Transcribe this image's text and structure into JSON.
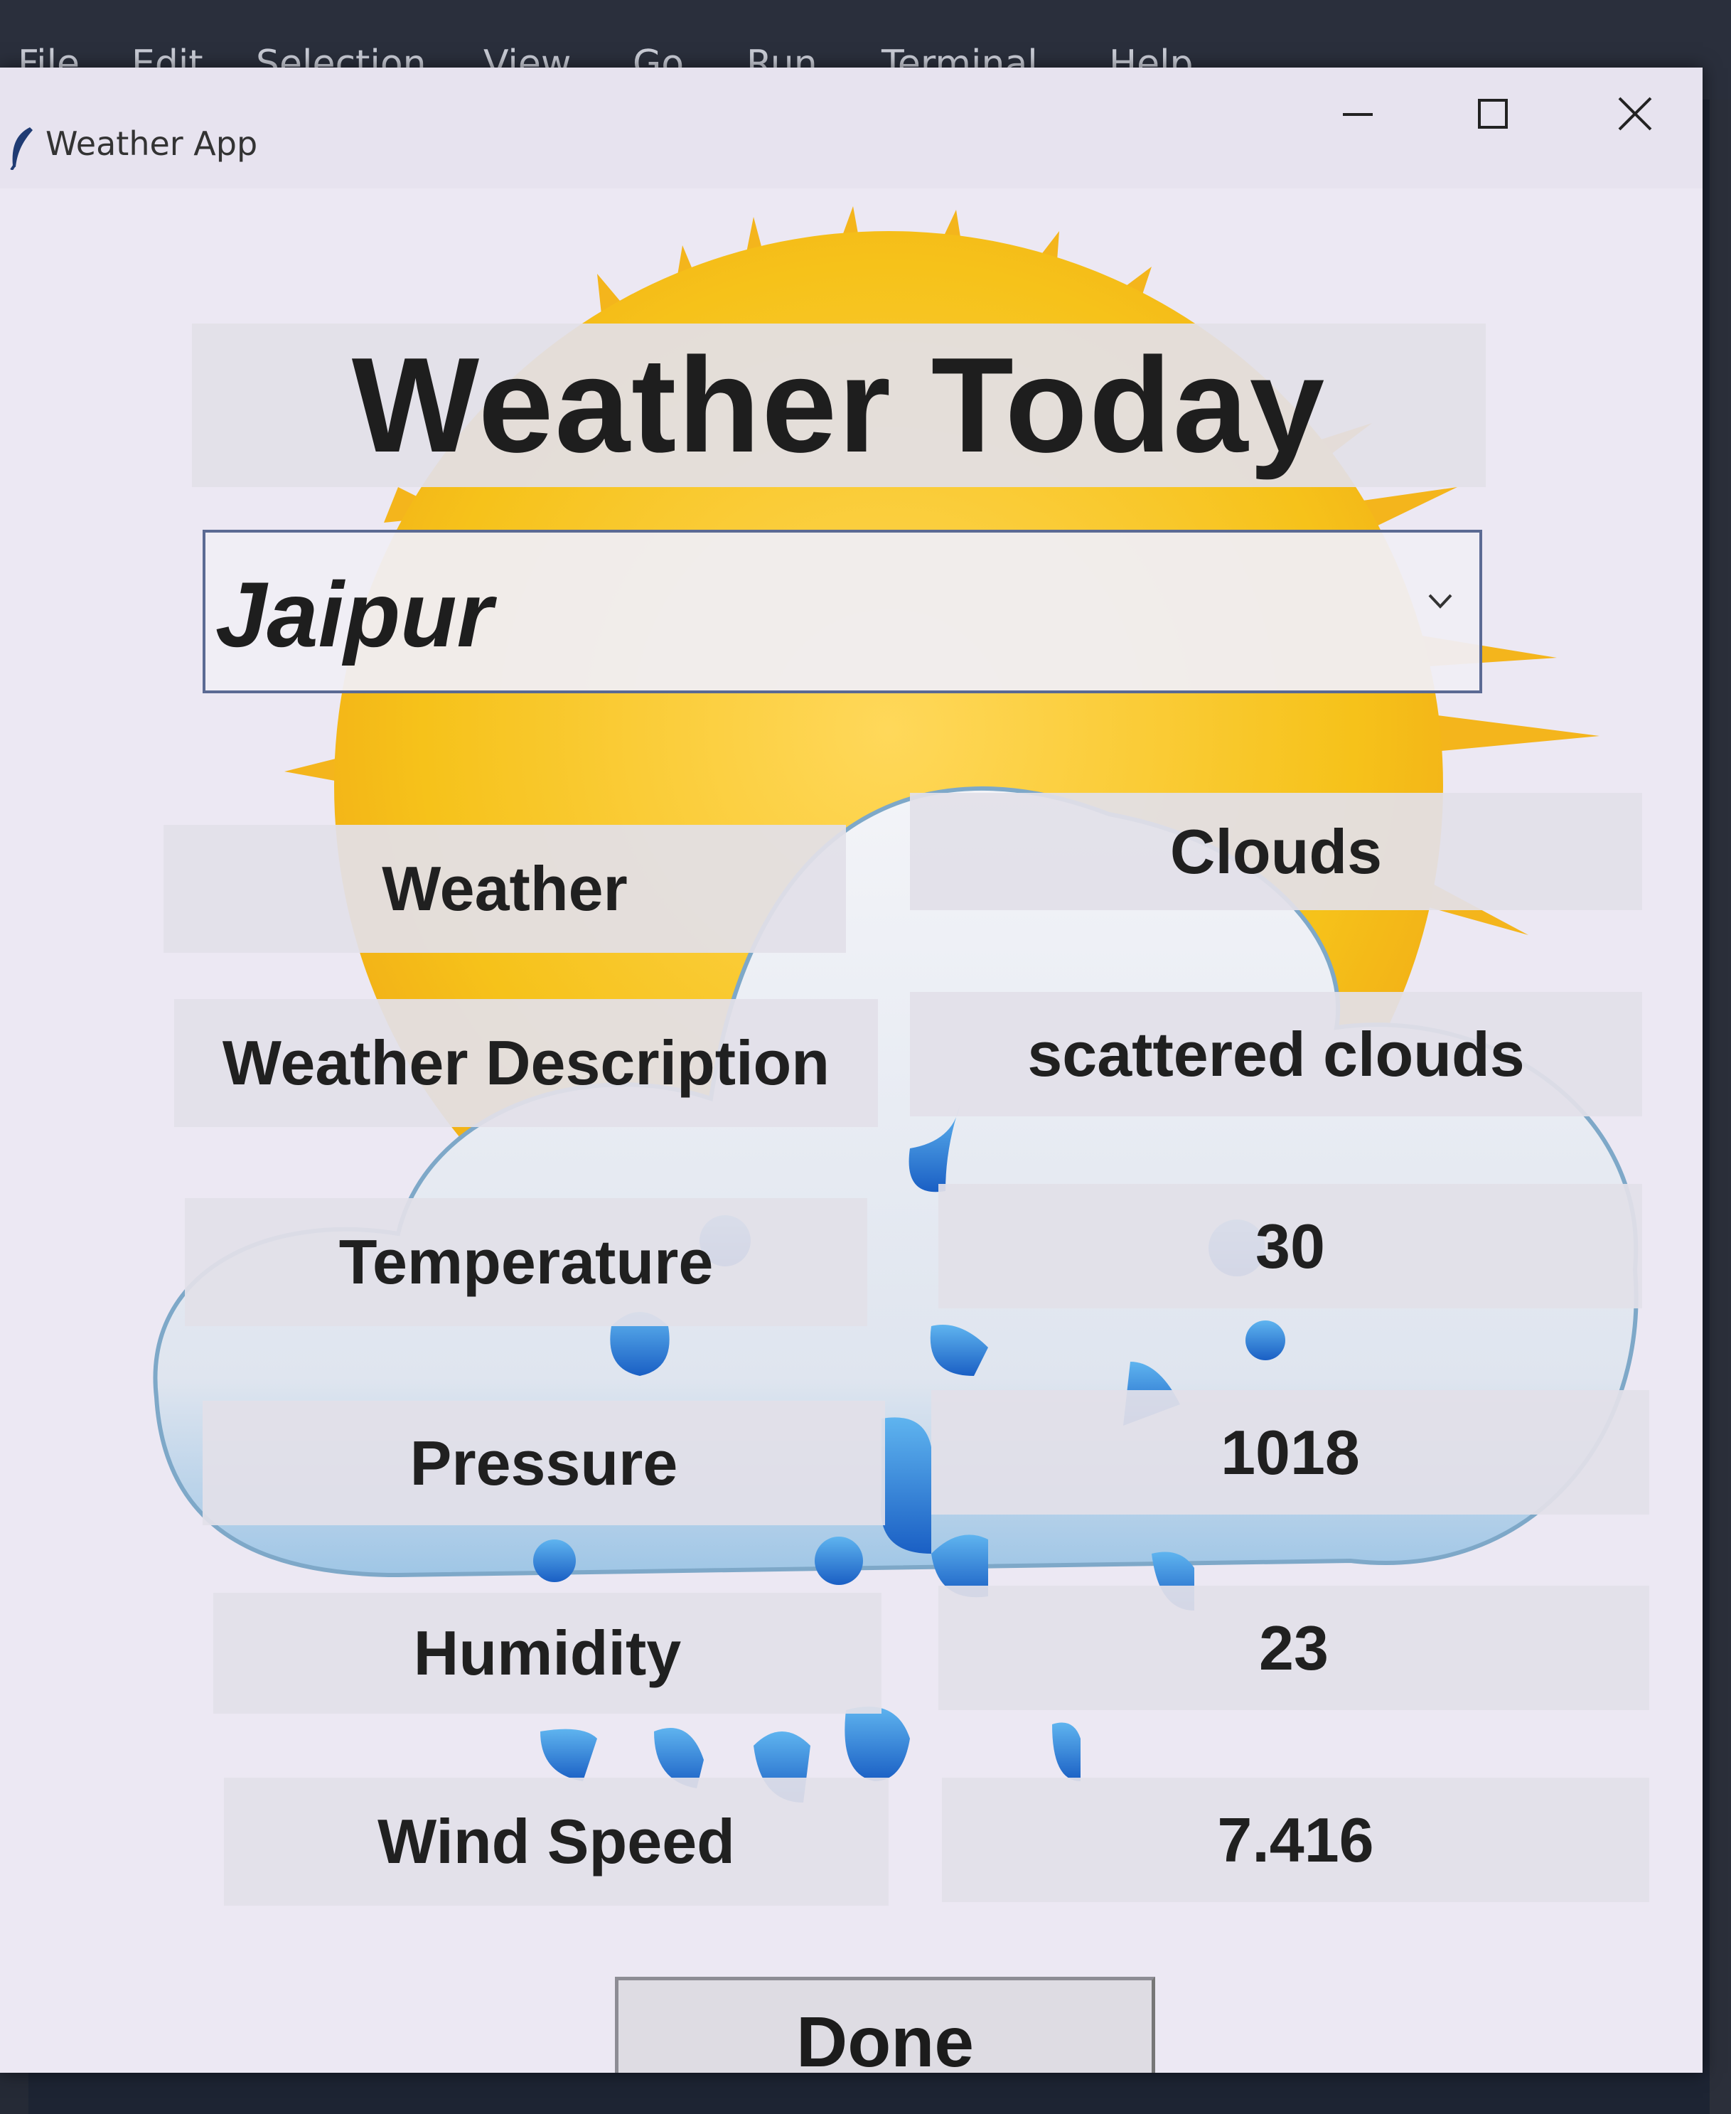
{
  "editor_menu": [
    "File",
    "Edit",
    "Selection",
    "View",
    "Go",
    "Run",
    "Terminal",
    "Help"
  ],
  "window": {
    "title": "Weather App",
    "icon": "feather-icon",
    "controls": [
      "minimize-icon",
      "maximize-icon",
      "close-icon"
    ]
  },
  "heading": "Weather Today",
  "city_select": {
    "value": "Jaipur",
    "icon": "chevron-down-icon"
  },
  "rows": [
    {
      "label": "Weather",
      "value": "Clouds"
    },
    {
      "label": "Weather Description",
      "value": "scattered clouds"
    },
    {
      "label": "Temperature",
      "value": "30"
    },
    {
      "label": "Pressure",
      "value": "1018"
    },
    {
      "label": "Humidity",
      "value": "23"
    },
    {
      "label": "Wind Speed",
      "value": "7.416"
    }
  ],
  "done_button": "Done",
  "colors": {
    "sun": "#f6c21a",
    "sun_ray": "#f4a21a",
    "cloud": "#dfe4ee",
    "rain": "#1f6fd0",
    "window_bg": "#ece8f3",
    "cell_bg": "#e2e0e8"
  }
}
